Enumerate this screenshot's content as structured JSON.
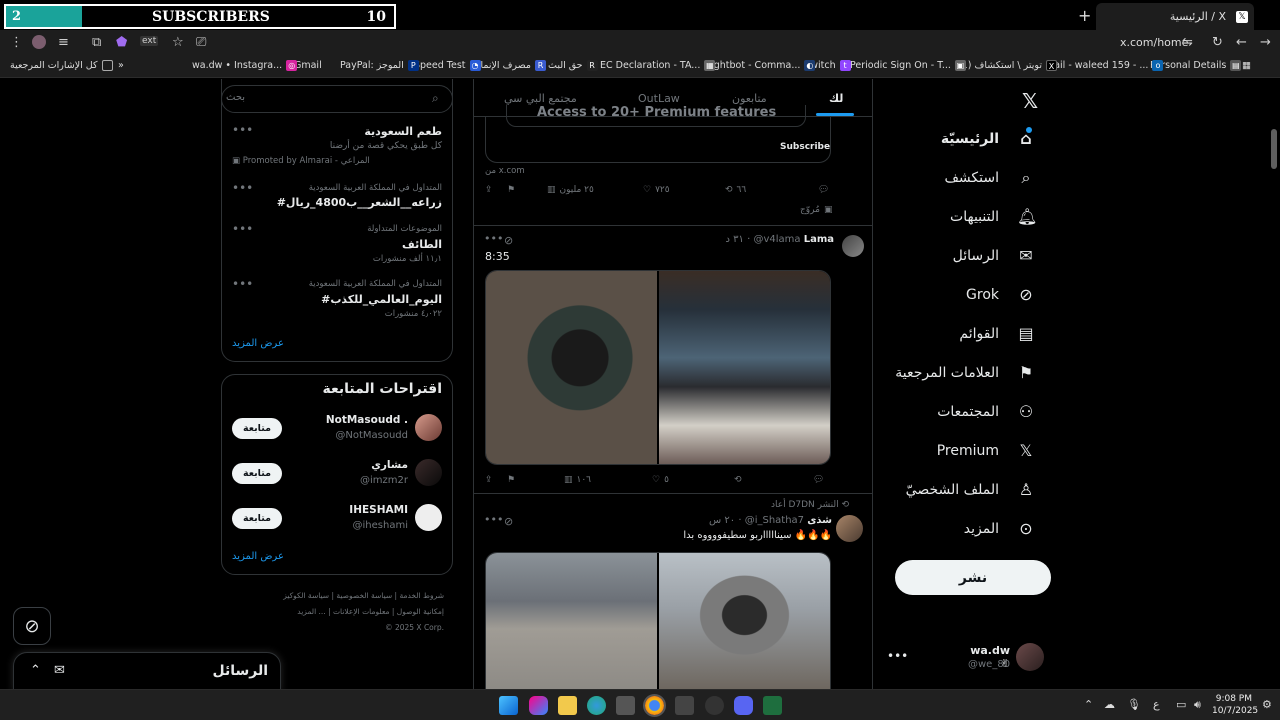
{
  "subscriber_overlay": {
    "left_value": "2",
    "label": "SUBSCRIBERS",
    "count": "10"
  },
  "browser": {
    "active_tab_title": "الرئيسية / X",
    "url": "x.com/home",
    "bookmarks": [
      "كل الإشارات المرجعية",
      "wa.dw • Instagra...",
      "Gmail",
      "PayPal: الموجز",
      "Speed Test",
      "مصرف الإنماء",
      "حق البث",
      "EC Declaration - TA...",
      "Nightbot - Comma...",
      "Twitch",
      "Periodic Sign On - T...",
      "(1) تويتر \\ استكشاف",
      "Mail - waleed 159 - ...",
      "Personal Details"
    ]
  },
  "nav": {
    "items": [
      {
        "label": "الرئيسيّة",
        "icon": "home-icon"
      },
      {
        "label": "استكشف",
        "icon": "search-icon"
      },
      {
        "label": "التنبيهات",
        "icon": "bell-icon"
      },
      {
        "label": "الرسائل",
        "icon": "mail-icon"
      },
      {
        "label": "Grok",
        "icon": "grok-icon"
      },
      {
        "label": "القوائم",
        "icon": "list-icon"
      },
      {
        "label": "العلامات المرجعية",
        "icon": "bookmark-icon"
      },
      {
        "label": "المجتمعات",
        "icon": "communities-icon"
      },
      {
        "label": "Premium",
        "icon": "x-premium-icon"
      },
      {
        "label": "الملف الشخصيّ",
        "icon": "profile-icon"
      },
      {
        "label": "المزيد",
        "icon": "more-icon"
      }
    ],
    "post_button": "نشر",
    "account_name": "wa.dw",
    "account_handle": "@we_80"
  },
  "feed": {
    "tabs": [
      "لك",
      "متابعون",
      "OutLaw",
      "مجتمع البي سي"
    ],
    "ad_post": {
      "banner_text": "Access to 20+ Premium features",
      "subscribe_label": "Subscribe",
      "source": "من x.com",
      "stats": {
        "replies": "",
        "reposts": "٦٦",
        "likes": "٧٢٥",
        "views": "٢٥ مليون"
      },
      "promoted_label": "مُروّج"
    },
    "tweet1": {
      "name": "Lama",
      "handle": "@v4lama",
      "time": "٣١ د",
      "text": "8:35",
      "stats": {
        "replies": "",
        "reposts": "",
        "likes": "٥",
        "views": "١٠٦"
      }
    },
    "tweet2": {
      "repost_label": "أعاد D7DN النشر",
      "name": "شذى",
      "handle": "@i_Shatha7",
      "time": "٢٠ س",
      "text": "سيناااااربو سطيفووووه بدا 🔥🔥🔥"
    }
  },
  "sidebar": {
    "search_placeholder": "بحث",
    "trends": [
      {
        "meta": "",
        "title": "طعم السعودية",
        "sub": "كل طبق يحكي قصة من أرضنا",
        "promoted": "Promoted by Almarai - المراعي"
      },
      {
        "meta": "المتداول في المملكة العربية السعودية",
        "title": "#زراعه__الشعر__ب4800_ريال",
        "sub": ""
      },
      {
        "meta": "الموضوعات المتداولة",
        "title": "الطائف",
        "sub": "١١٫١ ألف منشورات"
      },
      {
        "meta": "المتداول في المملكة العربية السعودية",
        "title": "#اليوم_العالمي_للكذب",
        "sub": "٤٫٠٢٢ منشورات"
      }
    ],
    "show_more": "عرض المزيد",
    "follow_title": "اقتراحات المتابعة",
    "follow": [
      {
        "name": "NotMasoudd .",
        "handle": "@NotMasoudd",
        "button": "متابعة"
      },
      {
        "name": "مشاري",
        "handle": "@imzm2r",
        "button": "متابعة"
      },
      {
        "name": "IHESHAMI",
        "handle": "@iheshami",
        "button": "متابعة"
      }
    ],
    "follow_more": "عرض المزيد",
    "footer": [
      "شروط الخدمة",
      "سياسة الخصوصية",
      "سياسة الكوكيز",
      "إمكانية الوصول",
      "معلومات الإعلانات",
      "... المزيد",
      "© 2025 X Corp."
    ]
  },
  "messages_drawer": {
    "title": "الرسائل"
  },
  "taskbar": {
    "time": "9:08 PM",
    "date": "10/7/2025",
    "lang": "ع"
  },
  "colors": {
    "accent": "#1d9bf0",
    "teal": "#1aa39a",
    "bg": "#000000"
  }
}
